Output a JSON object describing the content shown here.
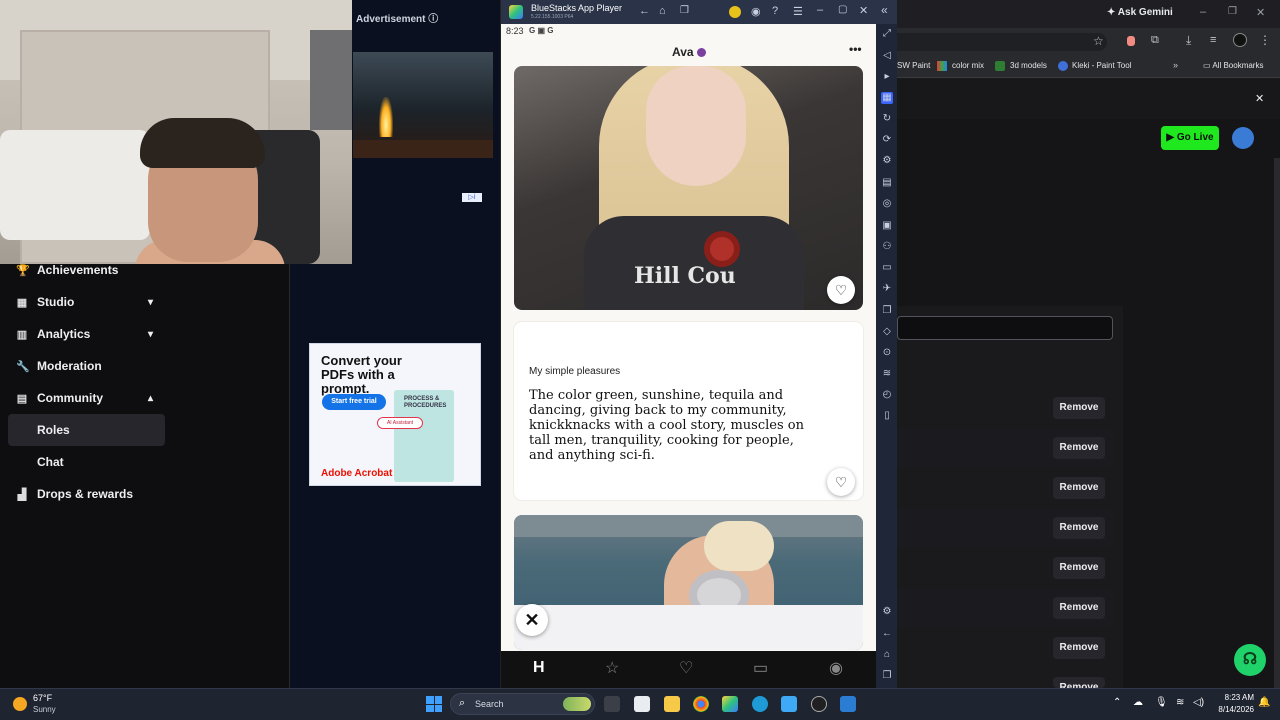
{
  "dashboard": {
    "sidebar": [
      {
        "label": "Achievements",
        "icon": "trophy-icon",
        "glyph": "🏆"
      },
      {
        "label": "Studio",
        "icon": "studio-icon",
        "glyph": "▦",
        "chevron": "▾"
      },
      {
        "label": "Analytics",
        "icon": "analytics-icon",
        "glyph": "▥",
        "chevron": "▾"
      },
      {
        "label": "Moderation",
        "icon": "wrench-icon",
        "glyph": "🔧"
      },
      {
        "label": "Community",
        "icon": "community-icon",
        "glyph": "▤",
        "chevron": "▴"
      },
      {
        "label": "Roles"
      },
      {
        "label": "Chat"
      },
      {
        "label": "Drops & rewards",
        "icon": "gift-icon",
        "glyph": "▟"
      }
    ]
  },
  "ads": {
    "heading": "Advertisement ⓘ",
    "pdf": {
      "headline": "Convert your PDFs with a prompt.",
      "cta": "Start free trial",
      "doc_title": "PROCESS & PROCEDURES",
      "ai": "AI Assistant",
      "brand": "Adobe Acrobat"
    }
  },
  "bluestacks": {
    "title": "BlueStacks App Player",
    "version": "5.22.155.1003 P64",
    "status_time": "8:23",
    "status_icons": "G ▣ G",
    "profile_name": "Ava",
    "menu": "•••",
    "shirt_text": "Hill Cou",
    "prompt_label": "My simple pleasures",
    "prompt_answer": "The color green, sunshine, tequila and dancing, giving back to my community, knickknacks with a cool story, muscles on tall men, tranquility, cooking for people, and anything sci-fi.",
    "nav": [
      "H",
      "☆",
      "♡",
      "▭",
      "◉"
    ],
    "close": "✕"
  },
  "browser": {
    "ask_gemini": "Ask Gemini",
    "bookmarks": [
      "SW Paint",
      "color mix",
      "3d models",
      "Kleki - Paint Tool"
    ],
    "all_bookmarks": "All Bookmarks",
    "go_live": "Go Live",
    "remove_label": "Remove",
    "remove_count": 8,
    "last_remove": "Remove"
  },
  "taskbar": {
    "temp": "67°F",
    "weather": "Sunny",
    "search": "Search",
    "time": "8:23 AM",
    "date": "8/14/2026"
  },
  "colors": {
    "go_live": "#1fe81f",
    "dark_bg": "#0e0e10",
    "bluestacks_bar": "#2a3347",
    "hinge_verified": "#7b3fa0"
  }
}
